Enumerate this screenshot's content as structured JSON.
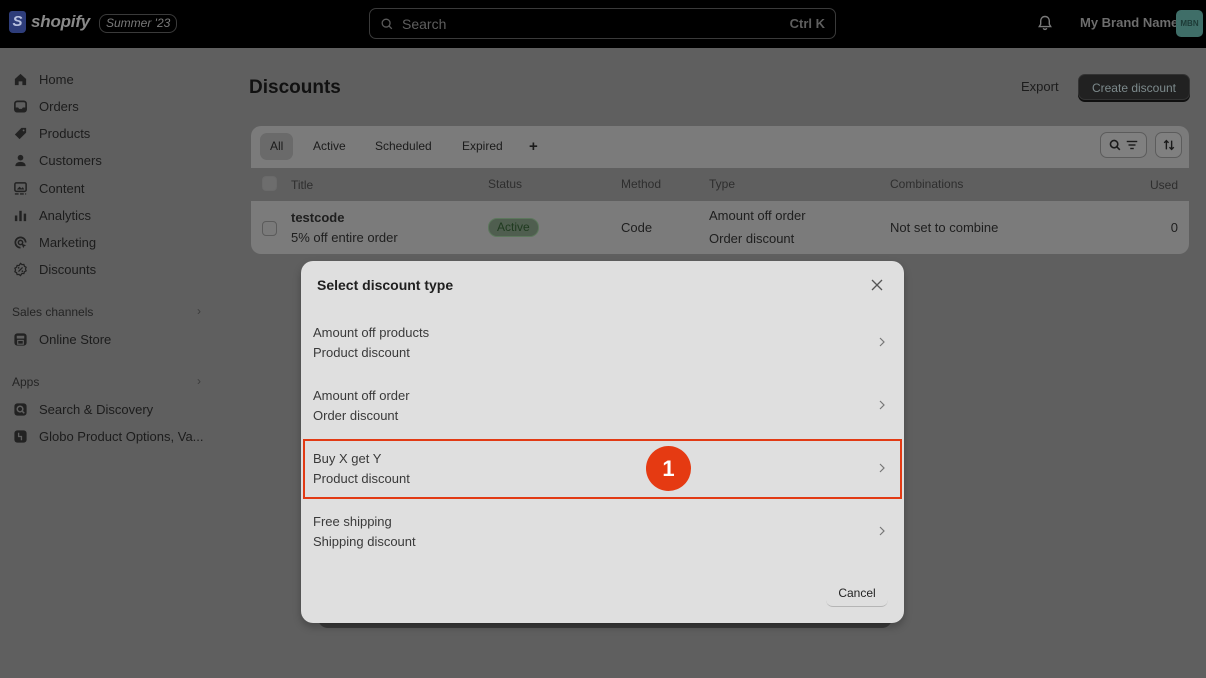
{
  "topbar": {
    "logo_text": "shopify",
    "logo_glyph": "S",
    "edition": "Summer '23",
    "search_placeholder": "Search",
    "search_shortcut": "Ctrl K",
    "notification_icon": "bell-icon",
    "brand_name": "My Brand Name",
    "avatar_initials": "MBN",
    "avatar_color": "#3f6e68"
  },
  "sidebar": {
    "items": [
      {
        "label": "Home",
        "icon": "home-icon"
      },
      {
        "label": "Orders",
        "icon": "inbox-icon"
      },
      {
        "label": "Products",
        "icon": "tag-icon"
      },
      {
        "label": "Customers",
        "icon": "person-icon"
      },
      {
        "label": "Content",
        "icon": "image-icon"
      },
      {
        "label": "Analytics",
        "icon": "bar-chart-icon"
      },
      {
        "label": "Marketing",
        "icon": "target-icon"
      },
      {
        "label": "Discounts",
        "icon": "discount-badge-icon"
      }
    ],
    "sales_channels": {
      "label": "Sales channels",
      "items": [
        {
          "label": "Online Store",
          "icon": "storefront-icon"
        }
      ]
    },
    "apps": {
      "label": "Apps",
      "items": [
        {
          "label": "Search & Discovery",
          "icon": "search-app-icon"
        },
        {
          "label": "Globo Product Options, Va...",
          "icon": "globo-app-icon"
        }
      ]
    }
  },
  "main": {
    "title": "Discounts",
    "export_label": "Export",
    "create_label": "Create discount",
    "tabs": [
      {
        "label": "All",
        "active": true
      },
      {
        "label": "Active",
        "active": false
      },
      {
        "label": "Scheduled",
        "active": false
      },
      {
        "label": "Expired",
        "active": false
      },
      {
        "label": "+",
        "active": false
      }
    ],
    "table": {
      "columns": [
        "Title",
        "Status",
        "Method",
        "Type",
        "Combinations",
        "Used"
      ],
      "rows": [
        {
          "title": "testcode",
          "subtitle": "5% off entire order",
          "status": "Active",
          "method": "Code",
          "type_line1": "Amount off order",
          "type_line2": "Order discount",
          "combinations": "Not set to combine",
          "used": "0"
        }
      ]
    }
  },
  "modal": {
    "title": "Select discount type",
    "options": [
      {
        "title": "Amount off products",
        "subtitle": "Product discount",
        "highlighted": false
      },
      {
        "title": "Amount off order",
        "subtitle": "Order discount",
        "highlighted": false
      },
      {
        "title": "Buy X get Y",
        "subtitle": "Product discount",
        "highlighted": true
      },
      {
        "title": "Free shipping",
        "subtitle": "Shipping discount",
        "highlighted": false
      }
    ],
    "cancel_label": "Cancel",
    "step_marker": "1",
    "highlight_color": "#e23a14"
  }
}
